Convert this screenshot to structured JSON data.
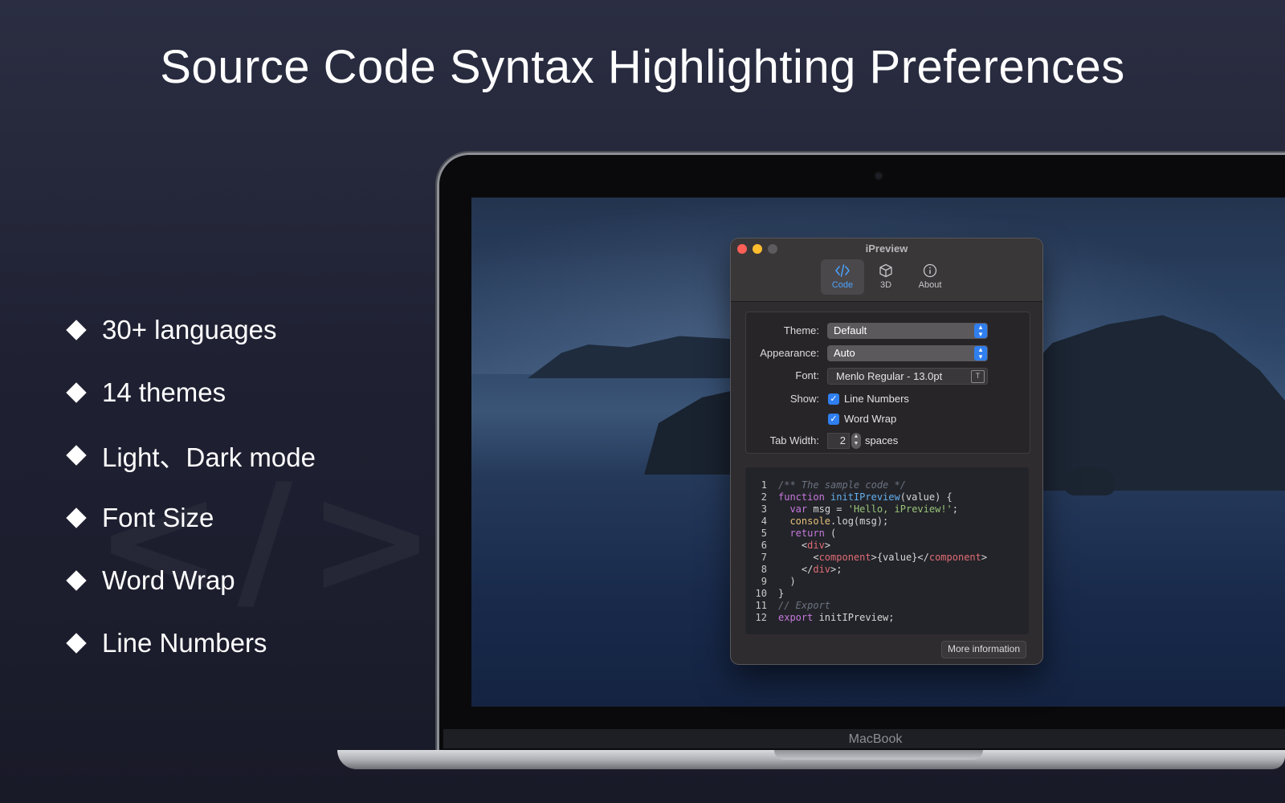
{
  "headline": "Source Code Syntax Highlighting Preferences",
  "watermark": "</>",
  "features": [
    "30+ languages",
    "14 themes",
    "Light、Dark mode",
    "Font Size",
    "Word Wrap",
    "Line Numbers"
  ],
  "laptop": {
    "brand": "MacBook"
  },
  "window": {
    "title": "iPreview",
    "toolbar": [
      {
        "label": "Code",
        "icon": "code-brackets-icon",
        "selected": true
      },
      {
        "label": "3D",
        "icon": "cube-icon",
        "selected": false
      },
      {
        "label": "About",
        "icon": "info-circle-icon",
        "selected": false
      }
    ],
    "settings": {
      "theme_label": "Theme:",
      "theme_value": "Default",
      "appearance_label": "Appearance:",
      "appearance_value": "Auto",
      "font_label": "Font:",
      "font_value": "Menlo Regular - 13.0pt",
      "show_label": "Show:",
      "line_numbers_label": "Line Numbers",
      "line_numbers_checked": true,
      "word_wrap_label": "Word Wrap",
      "word_wrap_checked": true,
      "tab_width_label": "Tab Width:",
      "tab_width_value": "2",
      "tab_width_unit": "spaces"
    },
    "code_lines": [
      {
        "n": "1",
        "text": "/** The sample code */"
      },
      {
        "n": "2",
        "text": "function initIPreview(value) {"
      },
      {
        "n": "3",
        "text": "  var msg = 'Hello, iPreview!';"
      },
      {
        "n": "4",
        "text": "  console.log(msg);"
      },
      {
        "n": "5",
        "text": "  return ("
      },
      {
        "n": "6",
        "text": "    <div>"
      },
      {
        "n": "7",
        "text": "      <component>{value}</component>"
      },
      {
        "n": "8",
        "text": "    </div>;"
      },
      {
        "n": "9",
        "text": "  )"
      },
      {
        "n": "10",
        "text": "}"
      },
      {
        "n": "11",
        "text": "// Export"
      },
      {
        "n": "12",
        "text": "export initIPreview;"
      }
    ],
    "more_button": "More information"
  },
  "colors": {
    "accent": "#2f7ff0",
    "selected_tab": "#4aa3ff",
    "close": "#ff5f57",
    "minimize": "#febc2e",
    "syntax_keyword": "#c678dd",
    "syntax_function": "#61afef",
    "syntax_string": "#98c379",
    "syntax_comment": "#6b7280",
    "syntax_tag": "#e06c75"
  }
}
